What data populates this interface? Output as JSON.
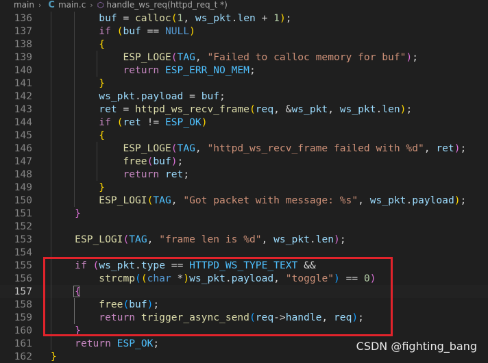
{
  "breadcrumb": {
    "folder": "main",
    "file": "main.c",
    "symbol": "handle_ws_req(httpd_req_t *)",
    "chevron": "›"
  },
  "editor": {
    "current_line": 157,
    "lines": [
      {
        "n": "136",
        "segs": [
          [
            "p",
            "        "
          ],
          [
            "var",
            "buf"
          ],
          [
            "p",
            " = "
          ],
          [
            "fn",
            "calloc"
          ],
          [
            "b1",
            "("
          ],
          [
            "num",
            "1"
          ],
          [
            "p",
            ", "
          ],
          [
            "var",
            "ws_pkt"
          ],
          [
            "p",
            "."
          ],
          [
            "var",
            "len"
          ],
          [
            "p",
            " + "
          ],
          [
            "num",
            "1"
          ],
          [
            "b1",
            ")"
          ],
          [
            "p",
            ";"
          ]
        ]
      },
      {
        "n": "137",
        "segs": [
          [
            "p",
            "        "
          ],
          [
            "ctl",
            "if"
          ],
          [
            "p",
            " "
          ],
          [
            "b1",
            "("
          ],
          [
            "var",
            "buf"
          ],
          [
            "p",
            " == "
          ],
          [
            "kw",
            "NULL"
          ],
          [
            "b1",
            ")"
          ]
        ]
      },
      {
        "n": "138",
        "segs": [
          [
            "p",
            "        "
          ],
          [
            "b1",
            "{"
          ]
        ]
      },
      {
        "n": "139",
        "segs": [
          [
            "p",
            "            "
          ],
          [
            "mac",
            "ESP_LOGE"
          ],
          [
            "b2",
            "("
          ],
          [
            "const",
            "TAG"
          ],
          [
            "p",
            ", "
          ],
          [
            "str",
            "\"Failed to calloc memory for buf\""
          ],
          [
            "b2",
            ")"
          ],
          [
            "p",
            ";"
          ]
        ]
      },
      {
        "n": "140",
        "segs": [
          [
            "p",
            "            "
          ],
          [
            "ctl",
            "return"
          ],
          [
            "p",
            " "
          ],
          [
            "const",
            "ESP_ERR_NO_MEM"
          ],
          [
            "p",
            ";"
          ]
        ]
      },
      {
        "n": "141",
        "segs": [
          [
            "p",
            "        "
          ],
          [
            "b1",
            "}"
          ]
        ]
      },
      {
        "n": "142",
        "segs": [
          [
            "p",
            "        "
          ],
          [
            "var",
            "ws_pkt"
          ],
          [
            "p",
            "."
          ],
          [
            "var",
            "payload"
          ],
          [
            "p",
            " = "
          ],
          [
            "var",
            "buf"
          ],
          [
            "p",
            ";"
          ]
        ]
      },
      {
        "n": "143",
        "segs": [
          [
            "p",
            "        "
          ],
          [
            "var",
            "ret"
          ],
          [
            "p",
            " = "
          ],
          [
            "fn",
            "httpd_ws_recv_frame"
          ],
          [
            "b1",
            "("
          ],
          [
            "var",
            "req"
          ],
          [
            "p",
            ", &"
          ],
          [
            "var",
            "ws_pkt"
          ],
          [
            "p",
            ", "
          ],
          [
            "var",
            "ws_pkt"
          ],
          [
            "p",
            "."
          ],
          [
            "var",
            "len"
          ],
          [
            "b1",
            ")"
          ],
          [
            "p",
            ";"
          ]
        ]
      },
      {
        "n": "144",
        "segs": [
          [
            "p",
            "        "
          ],
          [
            "ctl",
            "if"
          ],
          [
            "p",
            " "
          ],
          [
            "b1",
            "("
          ],
          [
            "var",
            "ret"
          ],
          [
            "p",
            " != "
          ],
          [
            "const",
            "ESP_OK"
          ],
          [
            "b1",
            ")"
          ]
        ]
      },
      {
        "n": "145",
        "segs": [
          [
            "p",
            "        "
          ],
          [
            "b1",
            "{"
          ]
        ]
      },
      {
        "n": "146",
        "segs": [
          [
            "p",
            "            "
          ],
          [
            "mac",
            "ESP_LOGE"
          ],
          [
            "b2",
            "("
          ],
          [
            "const",
            "TAG"
          ],
          [
            "p",
            ", "
          ],
          [
            "str",
            "\"httpd_ws_recv_frame failed with %d\""
          ],
          [
            "p",
            ", "
          ],
          [
            "var",
            "ret"
          ],
          [
            "b2",
            ")"
          ],
          [
            "p",
            ";"
          ]
        ]
      },
      {
        "n": "147",
        "segs": [
          [
            "p",
            "            "
          ],
          [
            "fn",
            "free"
          ],
          [
            "b2",
            "("
          ],
          [
            "var",
            "buf"
          ],
          [
            "b2",
            ")"
          ],
          [
            "p",
            ";"
          ]
        ]
      },
      {
        "n": "148",
        "segs": [
          [
            "p",
            "            "
          ],
          [
            "ctl",
            "return"
          ],
          [
            "p",
            " "
          ],
          [
            "var",
            "ret"
          ],
          [
            "p",
            ";"
          ]
        ]
      },
      {
        "n": "149",
        "segs": [
          [
            "p",
            "        "
          ],
          [
            "b1",
            "}"
          ]
        ]
      },
      {
        "n": "150",
        "segs": [
          [
            "p",
            "        "
          ],
          [
            "mac",
            "ESP_LOGI"
          ],
          [
            "b1",
            "("
          ],
          [
            "const",
            "TAG"
          ],
          [
            "p",
            ", "
          ],
          [
            "str",
            "\"Got packet with message: %s\""
          ],
          [
            "p",
            ", "
          ],
          [
            "var",
            "ws_pkt"
          ],
          [
            "p",
            "."
          ],
          [
            "var",
            "payload"
          ],
          [
            "b1",
            ")"
          ],
          [
            "p",
            ";"
          ]
        ]
      },
      {
        "n": "151",
        "segs": [
          [
            "p",
            "    "
          ],
          [
            "b2",
            "}"
          ]
        ]
      },
      {
        "n": "152",
        "segs": []
      },
      {
        "n": "153",
        "segs": [
          [
            "p",
            "    "
          ],
          [
            "mac",
            "ESP_LOGI"
          ],
          [
            "b2",
            "("
          ],
          [
            "const",
            "TAG"
          ],
          [
            "p",
            ", "
          ],
          [
            "str",
            "\"frame len is %d\""
          ],
          [
            "p",
            ", "
          ],
          [
            "var",
            "ws_pkt"
          ],
          [
            "p",
            "."
          ],
          [
            "var",
            "len"
          ],
          [
            "b2",
            ")"
          ],
          [
            "p",
            ";"
          ]
        ]
      },
      {
        "n": "154",
        "segs": []
      },
      {
        "n": "155",
        "segs": [
          [
            "p",
            "    "
          ],
          [
            "ctl",
            "if"
          ],
          [
            "p",
            " "
          ],
          [
            "b2",
            "("
          ],
          [
            "var",
            "ws_pkt"
          ],
          [
            "p",
            "."
          ],
          [
            "var",
            "type"
          ],
          [
            "p",
            " == "
          ],
          [
            "const",
            "HTTPD_WS_TYPE_TEXT"
          ],
          [
            "p",
            " &&"
          ]
        ]
      },
      {
        "n": "156",
        "segs": [
          [
            "p",
            "        "
          ],
          [
            "fn",
            "strcmp"
          ],
          [
            "b3",
            "("
          ],
          [
            "b1",
            "("
          ],
          [
            "kw",
            "char"
          ],
          [
            "p",
            " *"
          ],
          [
            "b1",
            ")"
          ],
          [
            "var",
            "ws_pkt"
          ],
          [
            "p",
            "."
          ],
          [
            "var",
            "payload"
          ],
          [
            "p",
            ", "
          ],
          [
            "str",
            "\"toggle\""
          ],
          [
            "b3",
            ")"
          ],
          [
            "p",
            " == "
          ],
          [
            "num",
            "0"
          ],
          [
            "b2",
            ")"
          ]
        ]
      },
      {
        "n": "157",
        "segs": [
          [
            "p",
            "    "
          ],
          [
            "b2",
            "{"
          ]
        ]
      },
      {
        "n": "158",
        "segs": [
          [
            "p",
            "        "
          ],
          [
            "fn",
            "free"
          ],
          [
            "b3",
            "("
          ],
          [
            "var",
            "buf"
          ],
          [
            "b3",
            ")"
          ],
          [
            "p",
            ";"
          ]
        ]
      },
      {
        "n": "159",
        "segs": [
          [
            "p",
            "        "
          ],
          [
            "ctl",
            "return"
          ],
          [
            "p",
            " "
          ],
          [
            "fn",
            "trigger_async_send"
          ],
          [
            "b3",
            "("
          ],
          [
            "var",
            "req"
          ],
          [
            "p",
            "->"
          ],
          [
            "var",
            "handle"
          ],
          [
            "p",
            ", "
          ],
          [
            "var",
            "req"
          ],
          [
            "b3",
            ")"
          ],
          [
            "p",
            ";"
          ]
        ]
      },
      {
        "n": "160",
        "segs": [
          [
            "p",
            "    "
          ],
          [
            "b2",
            "}"
          ]
        ]
      },
      {
        "n": "161",
        "segs": [
          [
            "p",
            "    "
          ],
          [
            "ctl",
            "return"
          ],
          [
            "p",
            " "
          ],
          [
            "const",
            "ESP_OK"
          ],
          [
            "p",
            ";"
          ]
        ]
      },
      {
        "n": "162",
        "segs": [
          [
            "b1",
            "}"
          ]
        ]
      }
    ]
  },
  "watermark": "CSDN @fighting_bang",
  "colors": {
    "background": "#1f1f1f",
    "highlight_border": "#e1232b",
    "line_number": "#858585"
  }
}
